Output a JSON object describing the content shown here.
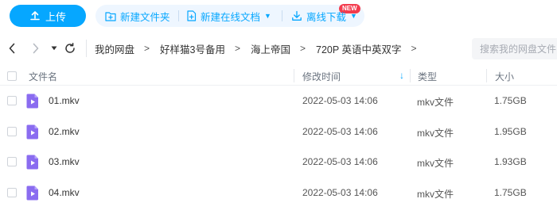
{
  "toolbar": {
    "upload_label": "上传",
    "new_folder_label": "新建文件夹",
    "new_online_doc_label": "新建在线文档",
    "new_badge": "NEW",
    "offline_download_label": "离线下载",
    "accent_color": "#06a7ff"
  },
  "breadcrumb": {
    "items": [
      "我的网盘",
      "好样猫3号备用",
      "海上帝国",
      "720P 英语中英双字"
    ],
    "separator": ">"
  },
  "search": {
    "placeholder": "搜索我的网盘文件"
  },
  "table": {
    "headers": {
      "name": "文件名",
      "modified": "修改时间",
      "type": "类型",
      "size": "大小"
    },
    "sort_indicator": "↓",
    "rows": [
      {
        "name": "01.mkv",
        "modified": "2022-05-03 14:06",
        "type": "mkv文件",
        "size": "1.75GB"
      },
      {
        "name": "02.mkv",
        "modified": "2022-05-03 14:06",
        "type": "mkv文件",
        "size": "1.95GB"
      },
      {
        "name": "03.mkv",
        "modified": "2022-05-03 14:06",
        "type": "mkv文件",
        "size": "1.93GB"
      },
      {
        "name": "04.mkv",
        "modified": "2022-05-03 14:06",
        "type": "mkv文件",
        "size": "1.75GB"
      }
    ]
  },
  "icons": {
    "upload": "upload-icon",
    "new_folder": "new-folder-icon",
    "new_doc": "new-doc-icon",
    "download": "download-icon",
    "back": "chevron-left-icon",
    "forward": "chevron-right-icon",
    "history": "caret-down-icon",
    "refresh": "refresh-icon",
    "file": "video-file-icon"
  },
  "colors": {
    "video_file_icon": "#8a6cf0",
    "new_badge": "#f33c4e"
  }
}
